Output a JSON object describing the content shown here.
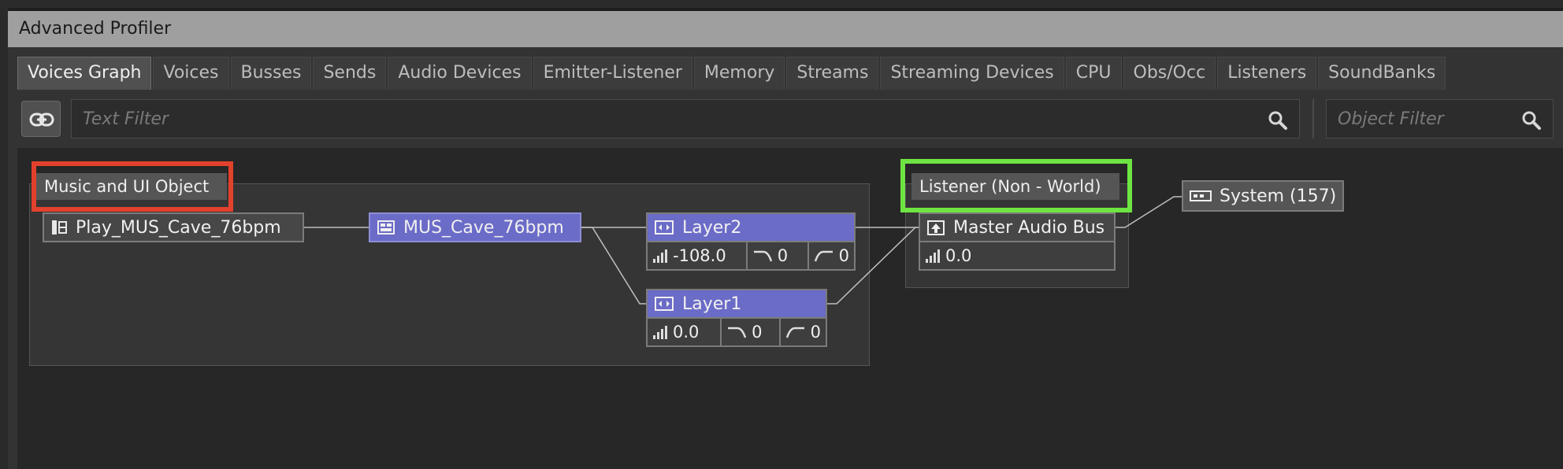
{
  "window": {
    "title": "Advanced Profiler"
  },
  "tabs": [
    {
      "label": "Voices Graph",
      "active": true
    },
    {
      "label": "Voices"
    },
    {
      "label": "Busses"
    },
    {
      "label": "Sends"
    },
    {
      "label": "Audio Devices"
    },
    {
      "label": "Emitter-Listener"
    },
    {
      "label": "Memory"
    },
    {
      "label": "Streams"
    },
    {
      "label": "Streaming Devices"
    },
    {
      "label": "CPU"
    },
    {
      "label": "Obs/Occ"
    },
    {
      "label": "Listeners"
    },
    {
      "label": "SoundBanks"
    }
  ],
  "filters": {
    "text_placeholder": "Text Filter",
    "object_placeholder": "Object Filter"
  },
  "graph": {
    "emitter_group": {
      "label": "Music and UI Object"
    },
    "listener_group": {
      "label": "Listener (Non - World)"
    },
    "nodes": {
      "play_event": {
        "label": "Play_MUS_Cave_76bpm"
      },
      "mus_cave": {
        "label": "MUS_Cave_76bpm"
      },
      "layer2": {
        "label": "Layer2",
        "volume": "-108.0",
        "lpf": "0",
        "hpf": "0"
      },
      "layer1": {
        "label": "Layer1",
        "volume": "0.0",
        "lpf": "0",
        "hpf": "0"
      },
      "master_bus": {
        "label": "Master Audio Bus",
        "volume": "0.0"
      },
      "system": {
        "label": "System (157)"
      }
    }
  },
  "colors": {
    "selected_node": "#6b6bc8",
    "highlight_red": "#e2412d",
    "highlight_green": "#6ee442"
  }
}
